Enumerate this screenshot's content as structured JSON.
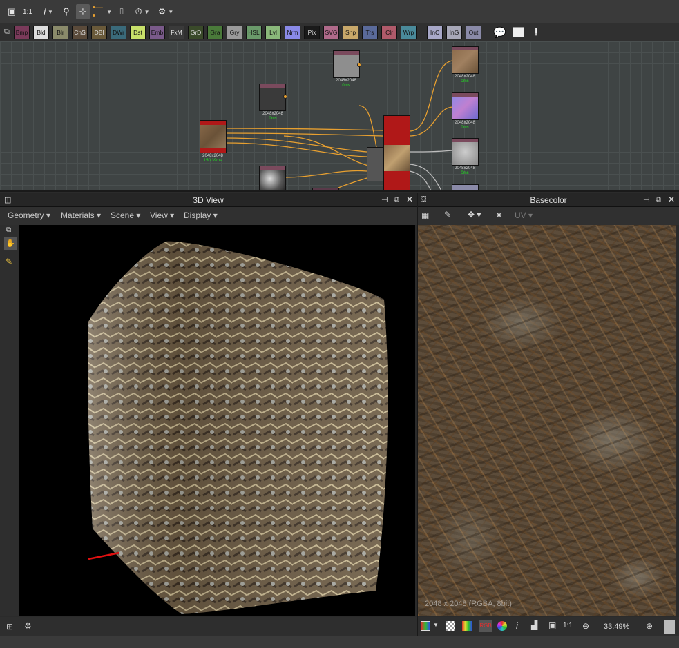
{
  "toolbar": {
    "items": [
      {
        "name": "fit-icon",
        "glyph": "▣"
      },
      {
        "name": "zoom-1to1-label",
        "glyph": "1:1"
      },
      {
        "name": "info-icon",
        "glyph": "i"
      },
      {
        "name": "search-icon",
        "glyph": "⚲"
      },
      {
        "name": "snap-icon",
        "glyph": "⊹"
      },
      {
        "name": "link-style-icon",
        "glyph": "•—•"
      },
      {
        "name": "stair-icon",
        "glyph": "⎍"
      },
      {
        "name": "timer-icon",
        "glyph": "⏱"
      },
      {
        "name": "gear-icon",
        "glyph": "⚙"
      }
    ]
  },
  "palette": {
    "nodes": [
      {
        "label": "Bmp",
        "color": "#7a3a5a"
      },
      {
        "label": "Bld",
        "color": "#dedede"
      },
      {
        "label": "Blr",
        "color": "#8a8a6a"
      },
      {
        "label": "ChS",
        "color": "#5a4a3a"
      },
      {
        "label": "DBl",
        "color": "#6a5a3a"
      },
      {
        "label": "DWr",
        "color": "#3a6a7a"
      },
      {
        "label": "Dst",
        "color": "#c8e06a"
      },
      {
        "label": "Emb",
        "color": "#7a5a8a"
      },
      {
        "label": "FxM",
        "color": "#3a3a3a"
      },
      {
        "label": "GrD",
        "color": "#3a4a2a"
      },
      {
        "label": "Gra",
        "color": "#4a7a3a"
      },
      {
        "label": "Gry",
        "color": "#9a9a9a"
      },
      {
        "label": "HSL",
        "color": "#6a9a6a"
      },
      {
        "label": "Lvl",
        "color": "#8ab87a"
      },
      {
        "label": "Nrm",
        "color": "#8a8ae8"
      },
      {
        "label": "Pix",
        "color": "#1a1a1a"
      },
      {
        "label": "SVG",
        "color": "#b06a8a"
      },
      {
        "label": "Shp",
        "color": "#c8a86a"
      },
      {
        "label": "Trs",
        "color": "#5a6a9a"
      },
      {
        "label": "Clr",
        "color": "#b05a6a"
      },
      {
        "label": "Wrp",
        "color": "#4a8a9a"
      },
      {
        "label": "InC",
        "color": "#a8a8c8"
      },
      {
        "label": "InG",
        "color": "#a8a8b8"
      },
      {
        "label": "Out",
        "color": "#8a8aa8"
      }
    ]
  },
  "graph": {
    "nodes": [
      {
        "id": "n1",
        "size": "2048x2048",
        "time": "0ms"
      },
      {
        "id": "n2",
        "size": "2048x2048",
        "time": "0ms"
      },
      {
        "id": "n3",
        "size": "2048x2048",
        "time": "150.39ms"
      },
      {
        "id": "o1",
        "size": "2048x2048",
        "time": "0ms"
      },
      {
        "id": "o2",
        "size": "2048x2048",
        "time": "0ms"
      },
      {
        "id": "o3",
        "size": "2048x2048",
        "time": "0ms"
      }
    ]
  },
  "view3d": {
    "title": "3D View",
    "menus": [
      "Geometry",
      "Materials",
      "Scene",
      "View",
      "Display"
    ]
  },
  "basecolor": {
    "title": "Basecolor",
    "uv_label": "UV",
    "overlay_text": "2048 x 2048 (RGBA, 8bit)",
    "zoom": "33.49%",
    "one_to_one": "1:1"
  },
  "colors": {
    "link": "#e8a030",
    "node_red": "#b01818",
    "time_green": "#22e022"
  }
}
